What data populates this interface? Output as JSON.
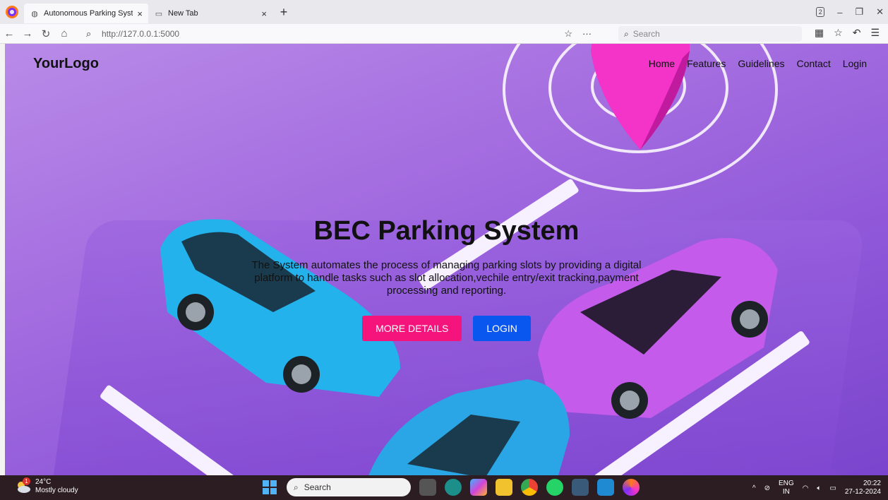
{
  "browser": {
    "tabs": [
      {
        "title": "Autonomous Parking System",
        "active": true
      },
      {
        "title": "New Tab",
        "active": false
      }
    ],
    "tab_count": "2",
    "url": "http://127.0.0.1:5000",
    "search_placeholder": "Search"
  },
  "site": {
    "logo": "YourLogo",
    "nav": [
      "Home",
      "Features",
      "Guidelines",
      "Contact",
      "Login"
    ],
    "hero_title": "BEC Parking System",
    "hero_text": "The System automates the process of managing parking slots by providing a digital platform to handle tasks such as slot allocation,vechile entry/exit tracking,payment processing and reporting.",
    "btn_details": "MORE DETAILS",
    "btn_login": "LOGIN"
  },
  "taskbar": {
    "weather_temp": "24°C",
    "weather_desc": "Mostly cloudy",
    "weather_badge": "1",
    "search_placeholder": "Search",
    "lang_top": "ENG",
    "lang_bottom": "IN",
    "time": "20:22",
    "date": "27-12-2024"
  },
  "colors": {
    "btn_details": "#f5147c",
    "btn_login": "#0a57f0",
    "taskbar": "#2b1d22"
  }
}
